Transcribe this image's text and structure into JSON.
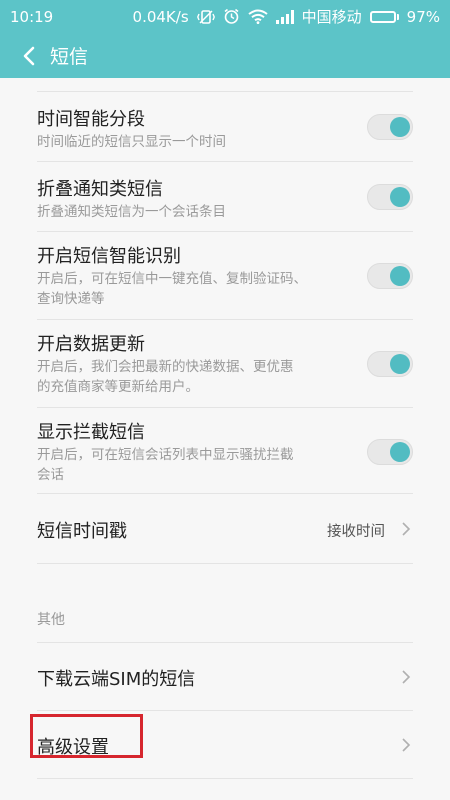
{
  "status_bar": {
    "time": "10:19",
    "net_speed": "0.04K/s",
    "carrier": "中国移动",
    "battery": "97%",
    "battery_level": 0.97
  },
  "header": {
    "title": "短信"
  },
  "settings": [
    {
      "title": "时间智能分段",
      "subtitle": "时间临近的短信只显示一个时间",
      "toggle": true
    },
    {
      "title": "折叠通知类短信",
      "subtitle": "折叠通知类短信为一个会话条目",
      "toggle": true
    },
    {
      "title": "开启短信智能识别",
      "subtitle_lines": [
        "开启后，可在短信中一键充值、复制验证码、",
        "查询快递等"
      ],
      "toggle": true
    },
    {
      "title": "开启数据更新",
      "subtitle_lines": [
        "开启后，我们会把最新的快递数据、更优惠",
        "的充值商家等更新给用户。"
      ],
      "toggle": true
    },
    {
      "title": "显示拦截短信",
      "subtitle_lines": [
        "开启后，可在短信会话列表中显示骚扰拦截",
        "会话"
      ],
      "toggle": true
    }
  ],
  "timestamp_row": {
    "title": "短信时间戳",
    "value": "接收时间"
  },
  "other_section": {
    "label": "其他",
    "items": [
      {
        "title": "下载云端SIM的短信"
      },
      {
        "title": "高级设置"
      }
    ]
  },
  "colors": {
    "accent": "#5cc4c8",
    "toggle_on": "#52bcc2",
    "highlight": "#d6262e"
  }
}
